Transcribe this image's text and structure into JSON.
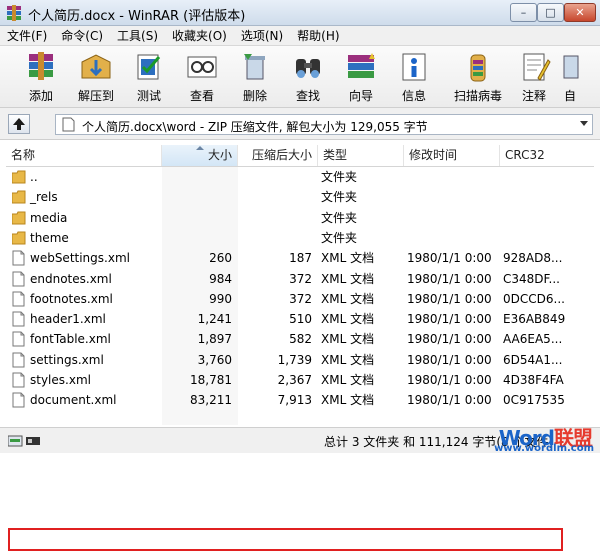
{
  "window": {
    "title": "个人简历.docx - WinRAR (评估版本)",
    "controls": {
      "minimize": "–",
      "maximize": "□",
      "close": "✕"
    }
  },
  "menu": [
    "文件(F)",
    "命令(C)",
    "工具(S)",
    "收藏夹(O)",
    "选项(N)",
    "帮助(H)"
  ],
  "toolbar": [
    {
      "label": "添加",
      "icon": "add-archive-icon"
    },
    {
      "label": "解压到",
      "icon": "extract-to-icon"
    },
    {
      "label": "测试",
      "icon": "test-icon"
    },
    {
      "label": "查看",
      "icon": "view-icon"
    },
    {
      "label": "删除",
      "icon": "delete-icon"
    },
    {
      "label": "查找",
      "icon": "find-icon"
    },
    {
      "label": "向导",
      "icon": "wizard-icon"
    },
    {
      "label": "信息",
      "icon": "info-icon"
    },
    {
      "label": "扫描病毒",
      "icon": "virus-scan-icon"
    },
    {
      "label": "注释",
      "icon": "comment-icon"
    },
    {
      "label": "自",
      "icon": "sfx-icon"
    }
  ],
  "address": {
    "path": "个人简历.docx\\word - ZIP 压缩文件, 解包大小为 129,055 字节"
  },
  "columns": [
    "名称",
    "大小",
    "压缩后大小",
    "类型",
    "修改时间",
    "CRC32"
  ],
  "files": [
    {
      "name": "..",
      "size": "",
      "packed": "",
      "type": "文件夹",
      "modified": "",
      "crc": "",
      "kind": "folder"
    },
    {
      "name": "_rels",
      "size": "",
      "packed": "",
      "type": "文件夹",
      "modified": "",
      "crc": "",
      "kind": "folder"
    },
    {
      "name": "media",
      "size": "",
      "packed": "",
      "type": "文件夹",
      "modified": "",
      "crc": "",
      "kind": "folder"
    },
    {
      "name": "theme",
      "size": "",
      "packed": "",
      "type": "文件夹",
      "modified": "",
      "crc": "",
      "kind": "folder"
    },
    {
      "name": "webSettings.xml",
      "size": "260",
      "packed": "187",
      "type": "XML 文档",
      "modified": "1980/1/1 0:00",
      "crc": "928AD8...",
      "kind": "file"
    },
    {
      "name": "endnotes.xml",
      "size": "984",
      "packed": "372",
      "type": "XML 文档",
      "modified": "1980/1/1 0:00",
      "crc": "C348DF...",
      "kind": "file"
    },
    {
      "name": "footnotes.xml",
      "size": "990",
      "packed": "372",
      "type": "XML 文档",
      "modified": "1980/1/1 0:00",
      "crc": "0DCCD6...",
      "kind": "file"
    },
    {
      "name": "header1.xml",
      "size": "1,241",
      "packed": "510",
      "type": "XML 文档",
      "modified": "1980/1/1 0:00",
      "crc": "E36AB849",
      "kind": "file"
    },
    {
      "name": "fontTable.xml",
      "size": "1,897",
      "packed": "582",
      "type": "XML 文档",
      "modified": "1980/1/1 0:00",
      "crc": "AA6EA5...",
      "kind": "file"
    },
    {
      "name": "settings.xml",
      "size": "3,760",
      "packed": "1,739",
      "type": "XML 文档",
      "modified": "1980/1/1 0:00",
      "crc": "6D54A1...",
      "kind": "file"
    },
    {
      "name": "styles.xml",
      "size": "18,781",
      "packed": "2,367",
      "type": "XML 文档",
      "modified": "1980/1/1 0:00",
      "crc": "4D38F4FA",
      "kind": "file"
    },
    {
      "name": "document.xml",
      "size": "83,211",
      "packed": "7,913",
      "type": "XML 文档",
      "modified": "1980/1/1 0:00",
      "crc": "0C917535",
      "kind": "file"
    }
  ],
  "status": {
    "text": "总计 3 文件夹 和 111,124 字节(8 个文件)",
    "watermark_brand_a": "Word",
    "watermark_brand_b": "联盟",
    "watermark_url": "www.wordlm.com"
  },
  "colors": {
    "highlight": "#e02020",
    "folder": "#e8b847",
    "accent": "#1b64c8"
  }
}
